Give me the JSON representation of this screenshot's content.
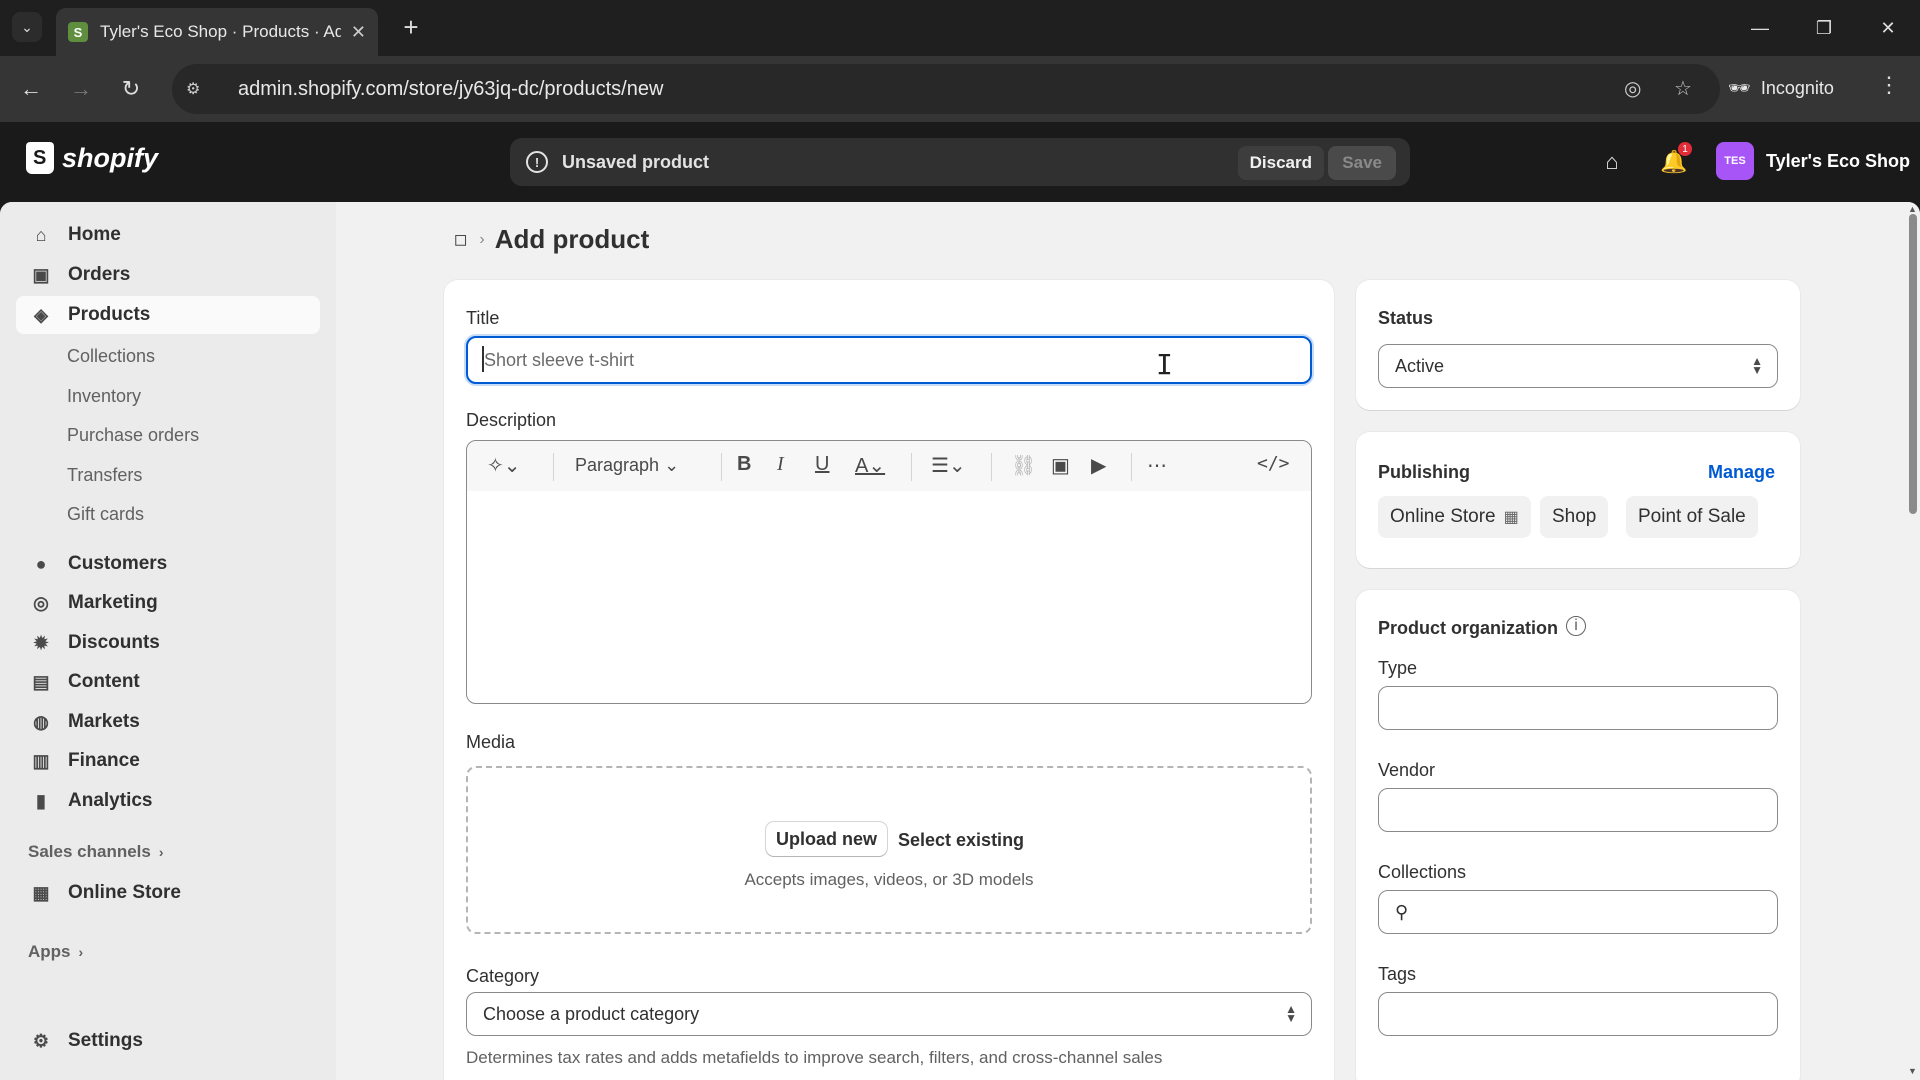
{
  "browser": {
    "tab_title": "Tyler's Eco Shop · Products · Ad",
    "favicon_letter": "S",
    "url": "admin.shopify.com/store/jy63jq-dc/products/new",
    "incognito_label": "Incognito"
  },
  "topbar": {
    "logo_text": "shopify",
    "unsaved_label": "Unsaved product",
    "discard_label": "Discard",
    "save_label": "Save",
    "notification_count": "1",
    "store_initials": "TES",
    "store_name": "Tyler's Eco Shop"
  },
  "sidebar": {
    "items": [
      {
        "label": "Home",
        "icon": "home-icon"
      },
      {
        "label": "Orders",
        "icon": "inbox-icon"
      },
      {
        "label": "Products",
        "icon": "tag-icon",
        "active": true
      },
      {
        "label": "Customers",
        "icon": "person-icon"
      },
      {
        "label": "Marketing",
        "icon": "target-icon"
      },
      {
        "label": "Discounts",
        "icon": "discount-icon"
      },
      {
        "label": "Content",
        "icon": "content-icon"
      },
      {
        "label": "Markets",
        "icon": "globe-icon"
      },
      {
        "label": "Finance",
        "icon": "bank-icon"
      },
      {
        "label": "Analytics",
        "icon": "bar-chart-icon"
      }
    ],
    "product_subitems": [
      "Collections",
      "Inventory",
      "Purchase orders",
      "Transfers",
      "Gift cards"
    ],
    "sales_channels_label": "Sales channels",
    "online_store_label": "Online Store",
    "apps_label": "Apps",
    "settings_label": "Settings"
  },
  "page": {
    "title": "Add product"
  },
  "form": {
    "title_label": "Title",
    "title_placeholder": "Short sleeve t-shirt",
    "description_label": "Description",
    "paragraph_label": "Paragraph",
    "media_label": "Media",
    "upload_new_label": "Upload new",
    "select_existing_label": "Select existing",
    "media_hint": "Accepts images, videos, or 3D models",
    "category_label": "Category",
    "category_placeholder": "Choose a product category",
    "category_hint": "Determines tax rates and adds metafields to improve search, filters, and cross-channel sales"
  },
  "status": {
    "label": "Status",
    "value": "Active"
  },
  "publishing": {
    "label": "Publishing",
    "manage_label": "Manage",
    "channels": [
      "Online Store",
      "Shop",
      "Point of Sale"
    ]
  },
  "organization": {
    "label": "Product organization",
    "type_label": "Type",
    "vendor_label": "Vendor",
    "collections_label": "Collections",
    "tags_label": "Tags"
  },
  "colors": {
    "focus_blue": "#005bd3",
    "link_blue": "#005bd3",
    "store_avatar": "#a855f7"
  }
}
